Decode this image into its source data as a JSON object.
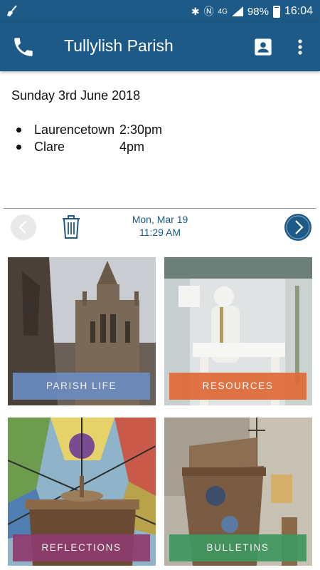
{
  "status_bar": {
    "battery": "98%",
    "time": "16:04",
    "network": "4G"
  },
  "app_bar": {
    "title": "Tullylish Parish"
  },
  "content": {
    "date_heading": "Sunday 3rd June 2018",
    "schedule": [
      {
        "place": "Laurencetown",
        "time": "2:30pm"
      },
      {
        "place": "Clare",
        "time": "4pm"
      }
    ]
  },
  "nav": {
    "date": "Mon, Mar 19",
    "time": "11:29 AM"
  },
  "tiles": [
    {
      "label": "PARISH LIFE",
      "color": "#6b8cc0"
    },
    {
      "label": "RESOURCES",
      "color": "#e06a37"
    },
    {
      "label": "REFLECTIONS",
      "color": "#8e3c6f"
    },
    {
      "label": "BULLETINS",
      "color": "#3f9760"
    }
  ],
  "colors": {
    "primary": "#1d5a87"
  }
}
